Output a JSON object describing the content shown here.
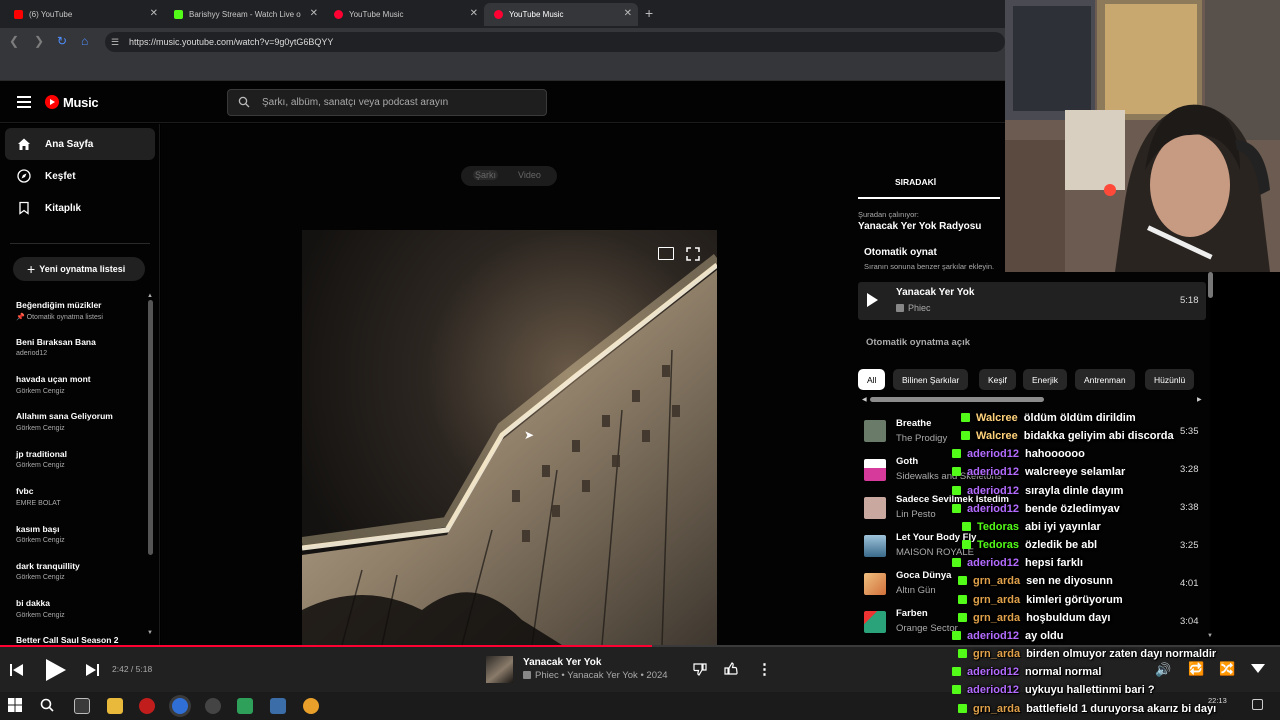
{
  "browser": {
    "tabs": [
      {
        "title": "(6) YouTube",
        "color": "#ff0000",
        "active": false
      },
      {
        "title": "Barishyy Stream - Watch Live o",
        "color": "#53fc18",
        "active": false
      },
      {
        "title": "YouTube Music",
        "color": "#ff0033",
        "active": false
      },
      {
        "title": "YouTube Music",
        "color": "#ff0033",
        "active": true
      }
    ],
    "new_tab": "+",
    "url": "https://music.youtube.com/watch?v=9g0ytG6BQYY"
  },
  "header": {
    "logo_text": "Music",
    "search_placeholder": "Şarkı, albüm, sanatçı veya podcast arayın"
  },
  "sidebar": {
    "nav": [
      {
        "label": "Ana Sayfa",
        "icon": "home-icon",
        "active": true
      },
      {
        "label": "Keşfet",
        "icon": "explore-icon",
        "active": false
      },
      {
        "label": "Kitaplık",
        "icon": "library-icon",
        "active": false
      }
    ],
    "new_playlist": "Yeni oynatma listesi",
    "playlists": [
      {
        "title": "Beğendiğim müzikler",
        "subtitle": "Otomatik oynatma listesi"
      },
      {
        "title": "Beni Bıraksan Bana",
        "subtitle": "aderiod12"
      },
      {
        "title": "havada uçan mont",
        "subtitle": "Görkem Cengiz"
      },
      {
        "title": "Allahım sana Geliyorum",
        "subtitle": "Görkem Cengiz"
      },
      {
        "title": "jp traditional",
        "subtitle": "Görkem Cengiz"
      },
      {
        "title": "fvbc",
        "subtitle": "EMRE BOLAT"
      },
      {
        "title": "kasım başı",
        "subtitle": "Görkem Cengiz"
      },
      {
        "title": "dark tranquillity",
        "subtitle": "Görkem Cengiz"
      },
      {
        "title": "bi dakka",
        "subtitle": "Görkem Cengiz"
      },
      {
        "title": "Better Call Saul Season 2",
        "subtitle": ""
      }
    ]
  },
  "main": {
    "toggle_song": "Şarkı",
    "toggle_video": "Video"
  },
  "right_panel": {
    "tab_upnext": "SIRADAKİ",
    "playing_from_label": "Şuradan çalınıyor:",
    "playing_from_name": "Yanacak Yer Yok Radyosu",
    "autoplay_title": "Otomatik oynat",
    "autoplay_desc": "Sıranın sonuna benzer şarkılar ekleyin.",
    "current": {
      "title": "Yanacak Yer Yok",
      "artist": "Phiec",
      "duration": "5:18"
    },
    "autoplay_on": "Otomatik oynatma açık",
    "chips": [
      "All",
      "Bilinen Şarkılar",
      "Keşif",
      "Enerjik",
      "Antrenman",
      "Hüzünlü"
    ],
    "queue": [
      {
        "title": "Breathe",
        "artist": "The Prodigy",
        "duration": "5:35",
        "color": "#6a7b6a"
      },
      {
        "title": "Goth",
        "artist": "Sidewalks and Skeletons",
        "duration": "3:28",
        "color": "#d63a9a"
      },
      {
        "title": "Sadece Sevilmek İstedim",
        "artist": "Lin Pesto",
        "duration": "3:38",
        "color": "#c9a8a0"
      },
      {
        "title": "Let Your Body Fly",
        "artist": "MAISON ROYALE",
        "duration": "3:25",
        "color": "#3a6a8a"
      },
      {
        "title": "Goca Dünya",
        "artist": "Altın Gün",
        "duration": "4:01",
        "color": "#d0703a"
      },
      {
        "title": "Farben",
        "artist": "Orange Sector",
        "duration": "3:04",
        "color": "#2aa37a"
      }
    ]
  },
  "player": {
    "time": "2:42 / 5:18",
    "progress": 0.509,
    "title": "Yanacak Yer Yok",
    "subtitle": "Phiec • Yanacak Yer Yok • 2024"
  },
  "chat": [
    {
      "user": "Walcree",
      "color": "#ffd27a",
      "msg": "öldüm öldüm dirildim"
    },
    {
      "user": "Walcree",
      "color": "#ffd27a",
      "msg": "bidakka geliyim abi discorda"
    },
    {
      "user": "aderiod12",
      "color": "#b36bff",
      "msg": "hahoooooo"
    },
    {
      "user": "aderiod12",
      "color": "#b36bff",
      "msg": "walcreeye selamlar"
    },
    {
      "user": "aderiod12",
      "color": "#b36bff",
      "msg": "sırayla dinle dayım"
    },
    {
      "user": "aderiod12",
      "color": "#b36bff",
      "msg": "bende özledimyav"
    },
    {
      "user": "Tedoras",
      "color": "#53fc18",
      "msg": "abi iyi yayınlar"
    },
    {
      "user": "Tedoras",
      "color": "#53fc18",
      "msg": "özledik be abl"
    },
    {
      "user": "aderiod12",
      "color": "#b36bff",
      "msg": "hepsi farklı"
    },
    {
      "user": "grn_arda",
      "color": "#e0a14a",
      "msg": "sen ne diyosunn"
    },
    {
      "user": "grn_arda",
      "color": "#e0a14a",
      "msg": "kimleri görüyorum"
    },
    {
      "user": "grn_arda",
      "color": "#e0a14a",
      "msg": "hoşbuldum dayı"
    },
    {
      "user": "aderiod12",
      "color": "#b36bff",
      "msg": "ay oldu"
    },
    {
      "user": "grn_arda",
      "color": "#e0a14a",
      "msg": "birden olmuyor zaten dayı normaldir"
    },
    {
      "user": "aderiod12",
      "color": "#b36bff",
      "msg": "normal normal"
    },
    {
      "user": "aderiod12",
      "color": "#b36bff",
      "msg": "uykuyu hallettinmi bari ?"
    },
    {
      "user": "grn_arda",
      "color": "#e0a14a",
      "msg": "battlefield 1 duruyorsa akarız bi dayı"
    }
  ],
  "taskbar": {
    "clock_time": "22:13"
  }
}
